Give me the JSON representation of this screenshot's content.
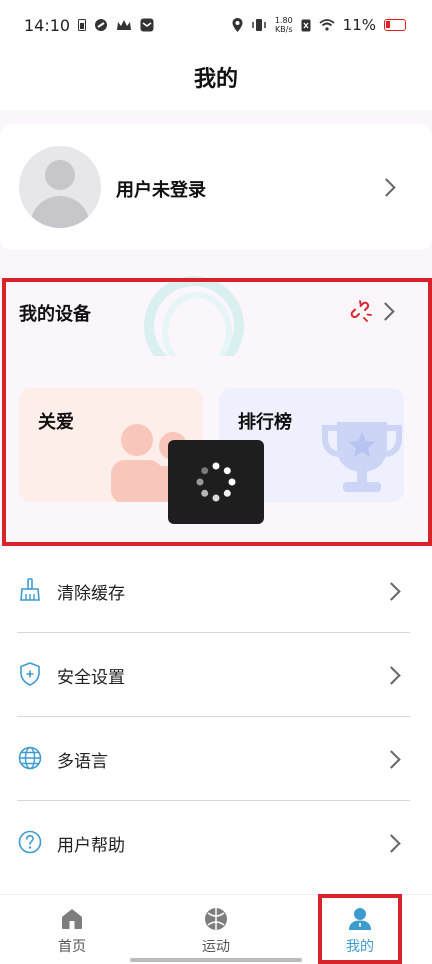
{
  "status_bar": {
    "time": "14:10",
    "net_speed_value": "1.80",
    "net_speed_unit": "KB/s",
    "battery_percent": "11%",
    "battery_color": "#e02020"
  },
  "header": {
    "title": "我的"
  },
  "profile": {
    "name": "用户未登录"
  },
  "device": {
    "title": "我的设备",
    "status_icon": "unlink-icon"
  },
  "cards": {
    "care": {
      "label": "关爱",
      "icon": "people-icon"
    },
    "rank": {
      "label": "排行榜",
      "icon": "trophy-icon"
    }
  },
  "menu": {
    "items": [
      {
        "label": "清除缓存",
        "icon": "broom-icon"
      },
      {
        "label": "安全设置",
        "icon": "shield-icon"
      },
      {
        "label": "多语言",
        "icon": "globe-icon"
      },
      {
        "label": "用户帮助",
        "icon": "help-icon"
      }
    ]
  },
  "bottom_nav": {
    "items": [
      {
        "label": "首页",
        "icon": "home-icon"
      },
      {
        "label": "运动",
        "icon": "ball-icon"
      },
      {
        "label": "我的",
        "icon": "user-icon",
        "active": true
      }
    ],
    "active_color": "#3e9bd0"
  },
  "colors": {
    "accent": "#3e9bd0",
    "highlight_box": "#d9232b",
    "care_card_bg": "#fdeeea",
    "rank_card_bg": "#eef1fd"
  }
}
